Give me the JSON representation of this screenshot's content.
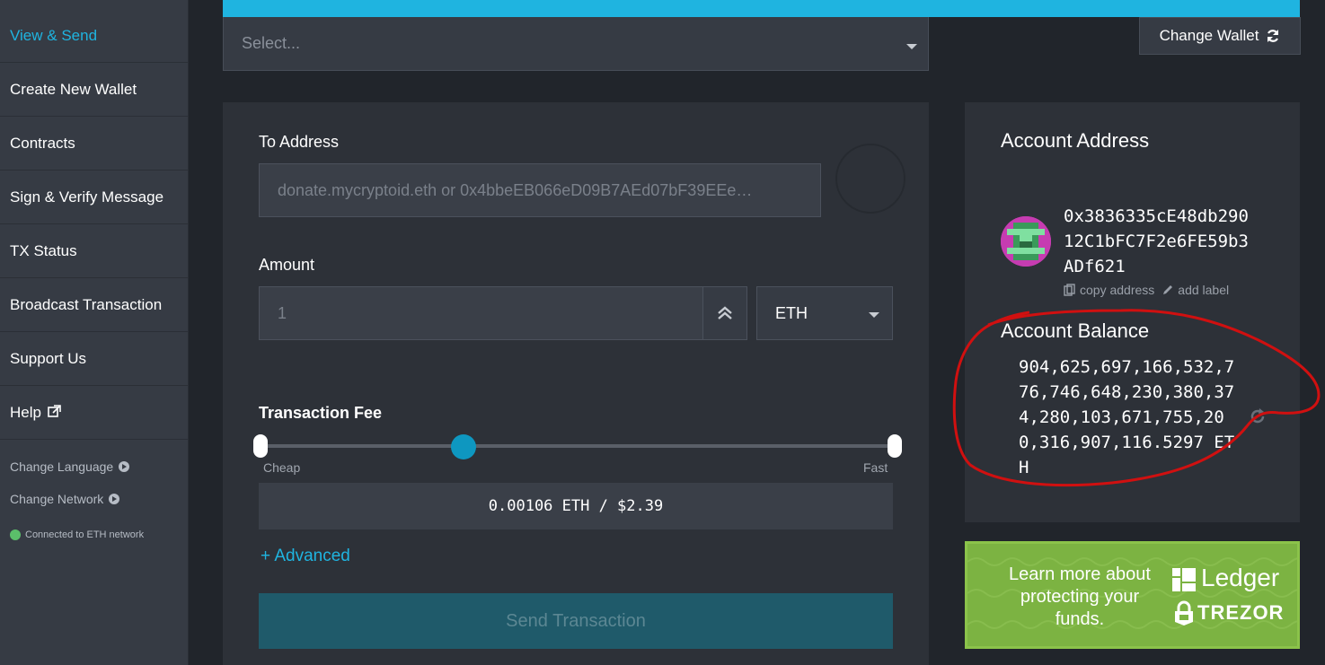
{
  "sidebar": {
    "items": [
      {
        "label": "View & Send",
        "active": true
      },
      {
        "label": "Create New Wallet"
      },
      {
        "label": "Contracts"
      },
      {
        "label": "Sign & Verify Message"
      },
      {
        "label": "TX Status"
      },
      {
        "label": "Broadcast Transaction"
      },
      {
        "label": "Support Us"
      },
      {
        "label": "Help"
      }
    ],
    "change_language": "Change Language",
    "change_network": "Change Network",
    "status": "Connected to ETH network"
  },
  "header": {
    "select_placeholder": "Select...",
    "change_wallet": "Change Wallet"
  },
  "send_form": {
    "to_address_label": "To Address",
    "to_address_placeholder": "donate.mycryptoid.eth or 0x4bbeEB066eD09B7AEd07bF39EEe…",
    "amount_label": "Amount",
    "amount_value": "1",
    "unit": "ETH",
    "fee_label": "Transaction Fee",
    "fee_level": 0.32,
    "cheap_label": "Cheap",
    "fast_label": "Fast",
    "fee_value": "0.00106 ETH / $2.39",
    "advanced_link": "+ Advanced",
    "send_button": "Send Transaction"
  },
  "account": {
    "address_title": "Account Address",
    "address": "0x3836335cE48db29012C1bFC7F2e6FE59b3ADf621",
    "copy_address": "copy address",
    "add_label": "add label",
    "balance_title": "Account Balance",
    "balance": "904,625,697,166,532,776,746,648,230,380,374,280,103,671,755,200,316,907,116.5297 ETH"
  },
  "promo": {
    "text": "Learn more about protecting your funds.",
    "brand_ledger": "Ledger",
    "brand_trezor": "TREZOR"
  },
  "colors": {
    "accent": "#1fb4e0",
    "promo": "#7cb342",
    "annotation": "#d01010"
  }
}
